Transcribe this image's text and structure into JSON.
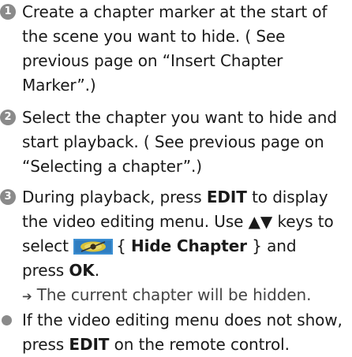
{
  "steps": [
    {
      "number": "1",
      "lines": [
        "Create a chapter marker at the start of",
        "the scene you want to hide. ( See",
        "previous page on “Insert Chapter",
        "Marker”.)"
      ]
    },
    {
      "number": "2",
      "lines": [
        "Select the chapter you want to hide and",
        "start playback. ( See previous page on",
        "“Selecting a chapter”.)"
      ]
    },
    {
      "number": "3",
      "line1_pre": "During playback, press ",
      "line1_key": "EDIT",
      "line1_post": " to display",
      "line2_pre": "the video editing menu. Use ",
      "line2_arrows": "▲▼",
      "line2_post": " keys to",
      "line3_pre": "select ",
      "line3_icon": "hide-chapter-eye-icon",
      "line3_open": "{ ",
      "line3_option": "Hide Chapter",
      "line3_close": " } and",
      "line4_pre": "press ",
      "line4_key": "OK",
      "line4_post": ".",
      "result_arrow": "➔",
      "result_text": " The current chapter will be hidden."
    }
  ],
  "note": {
    "line1": "If the video editing menu does not show,",
    "line2_pre": "press ",
    "line2_key": "EDIT",
    "line2_post": " on the remote control."
  },
  "colors": {
    "number_badge": "#8a8a8a",
    "icon_background": "#3c8fd2",
    "icon_eye": "#d9c23a"
  }
}
